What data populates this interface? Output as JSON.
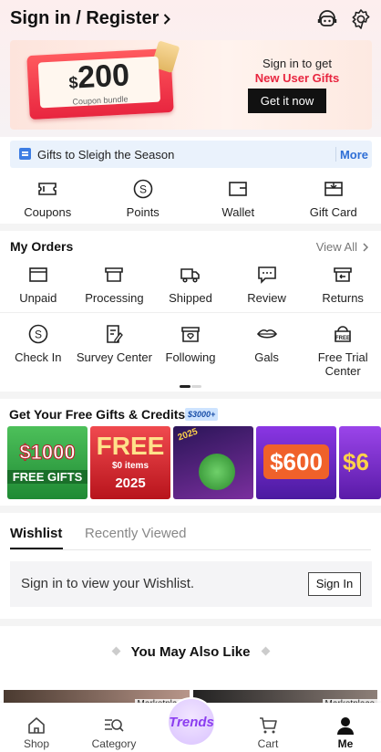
{
  "header": {
    "signin_label": "Sign in / Register",
    "support_icon": "headset-icon",
    "settings_icon": "gear-icon"
  },
  "banner": {
    "coupon_amount": "200",
    "coupon_currency": "$",
    "coupon_caption": "Coupon bundle",
    "line1": "Sign in to get",
    "line2": "New User Gifts",
    "button": "Get it now"
  },
  "gifts_bar": {
    "text": "Gifts to Sleigh the Season",
    "more": "More"
  },
  "wallet_row": [
    {
      "label": "Coupons",
      "icon": "coupon-icon"
    },
    {
      "label": "Points",
      "icon": "points-icon"
    },
    {
      "label": "Wallet",
      "icon": "wallet-icon"
    },
    {
      "label": "Gift Card",
      "icon": "gift-card-icon"
    }
  ],
  "orders": {
    "title": "My Orders",
    "view_all": "View All",
    "items": [
      {
        "label": "Unpaid",
        "icon": "unpaid-icon"
      },
      {
        "label": "Processing",
        "icon": "processing-icon"
      },
      {
        "label": "Shipped",
        "icon": "truck-icon"
      },
      {
        "label": "Review",
        "icon": "review-icon"
      },
      {
        "label": "Returns",
        "icon": "returns-icon"
      }
    ],
    "services": [
      {
        "label": "Check In",
        "icon": "check-in-icon"
      },
      {
        "label": "Survey Center",
        "icon": "survey-icon"
      },
      {
        "label": "Following",
        "icon": "store-icon"
      },
      {
        "label": "Gals",
        "icon": "lips-icon"
      },
      {
        "label": "Free Trial Center",
        "icon": "free-trial-icon"
      }
    ]
  },
  "free_gifts": {
    "title": "Get Your Free Gifts & Credits",
    "badge": "$3000+",
    "tiles": [
      {
        "line1": "$1000",
        "line2": "FREE GIFTS",
        "bg": "#3fa34d"
      },
      {
        "line1": "FREE",
        "line2": "$0 items",
        "line3": "2025",
        "bg": "#d8282f"
      },
      {
        "line1": "2025",
        "bg": "#4b1f7a"
      },
      {
        "line1": "$600",
        "bg": "#6a1fc4"
      },
      {
        "line1": "$6",
        "bg": "#7b2fd0"
      }
    ]
  },
  "wishlist": {
    "tab_wishlist": "Wishlist",
    "tab_recent": "Recently Viewed",
    "prompt": "Sign in to view your Wishlist.",
    "button": "Sign In"
  },
  "recommend": {
    "title": "You May Also Like",
    "tag_left": "Marketplace",
    "tag_right": "Marketplace"
  },
  "bottom_nav": [
    {
      "label": "Shop",
      "icon": "home-icon"
    },
    {
      "label": "Category",
      "icon": "category-icon"
    },
    {
      "label": "Trends",
      "icon": "trends-icon"
    },
    {
      "label": "Cart",
      "icon": "cart-icon"
    },
    {
      "label": "Me",
      "icon": "user-icon"
    }
  ]
}
